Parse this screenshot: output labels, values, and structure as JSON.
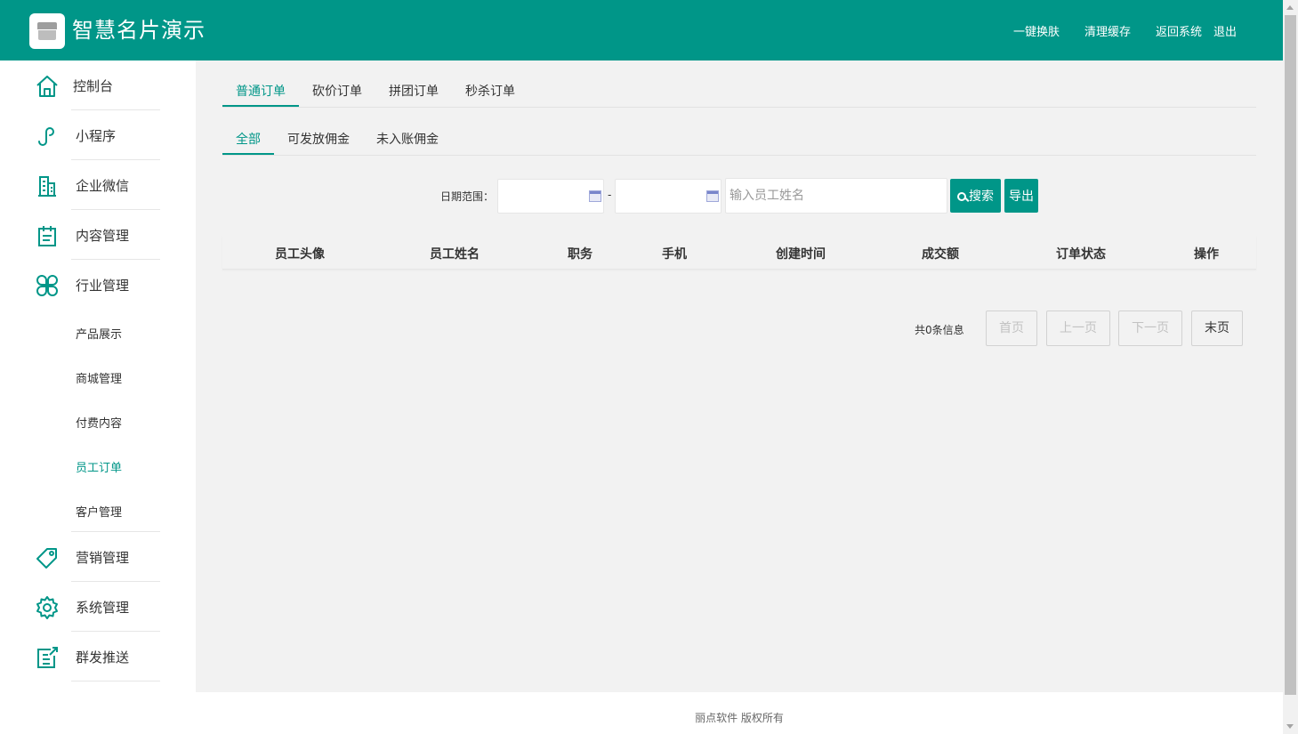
{
  "header": {
    "title": "智慧名片演示",
    "links": [
      "一键换肤",
      "清理缓存",
      "返回系统",
      "退出"
    ]
  },
  "sidebar": {
    "items": [
      {
        "label": "控制台",
        "icon": "home-icon"
      },
      {
        "label": "小程序",
        "icon": "miniprogram-icon"
      },
      {
        "label": "企业微信",
        "icon": "building-icon"
      },
      {
        "label": "内容管理",
        "icon": "clipboard-icon"
      },
      {
        "label": "行业管理",
        "icon": "clover-icon"
      },
      {
        "label": "营销管理",
        "icon": "tag-icon"
      },
      {
        "label": "系统管理",
        "icon": "gear-icon"
      },
      {
        "label": "群发推送",
        "icon": "edit-doc-icon"
      }
    ],
    "subitems": [
      "产品展示",
      "商城管理",
      "付费内容",
      "员工订单",
      "客户管理"
    ],
    "active_subitem": "员工订单"
  },
  "tabs_primary": [
    "普通订单",
    "砍价订单",
    "拼团订单",
    "秒杀订单"
  ],
  "tabs_secondary": [
    "全部",
    "可发放佣金",
    "未入账佣金"
  ],
  "filters": {
    "date_label": "日期范围：",
    "date_separator": "-",
    "start_date": "",
    "end_date": "",
    "name_placeholder": "输入员工姓名",
    "search_label": "搜索",
    "export_label": "导出"
  },
  "table": {
    "columns": [
      "员工头像",
      "员工姓名",
      "职务",
      "手机",
      "创建时间",
      "成交额",
      "订单状态",
      "操作"
    ],
    "rows": []
  },
  "pagination": {
    "total_text": "共0条信息",
    "first": "首页",
    "prev": "上一页",
    "next": "下一页",
    "last": "末页"
  },
  "footer": {
    "copyright": "丽点软件 版权所有"
  },
  "colors": {
    "primary": "#009688",
    "main_bg": "#f2f2f2"
  }
}
